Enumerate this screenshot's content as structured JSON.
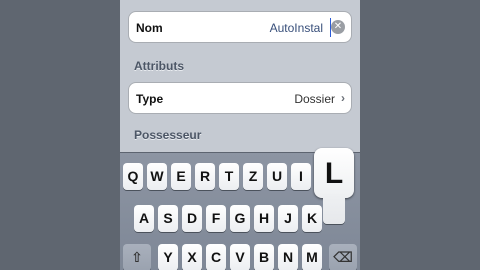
{
  "form": {
    "name_label": "Nom",
    "name_value": "AutoInstal",
    "clear_glyph": "✕",
    "attributes_header": "Attributs",
    "type_label": "Type",
    "type_value": "Dossier",
    "chevron_glyph": "›",
    "owner_header": "Possesseur"
  },
  "keyboard": {
    "row1": [
      "Q",
      "W",
      "E",
      "R",
      "T",
      "Z",
      "U",
      "I",
      "O"
    ],
    "row2": [
      "A",
      "S",
      "D",
      "F",
      "G",
      "H",
      "J",
      "K"
    ],
    "row3": [
      "Y",
      "X",
      "C",
      "V",
      "B",
      "N",
      "M"
    ],
    "shift_glyph": "⇧",
    "delete_glyph": "⌫",
    "pressed_key": "L"
  }
}
